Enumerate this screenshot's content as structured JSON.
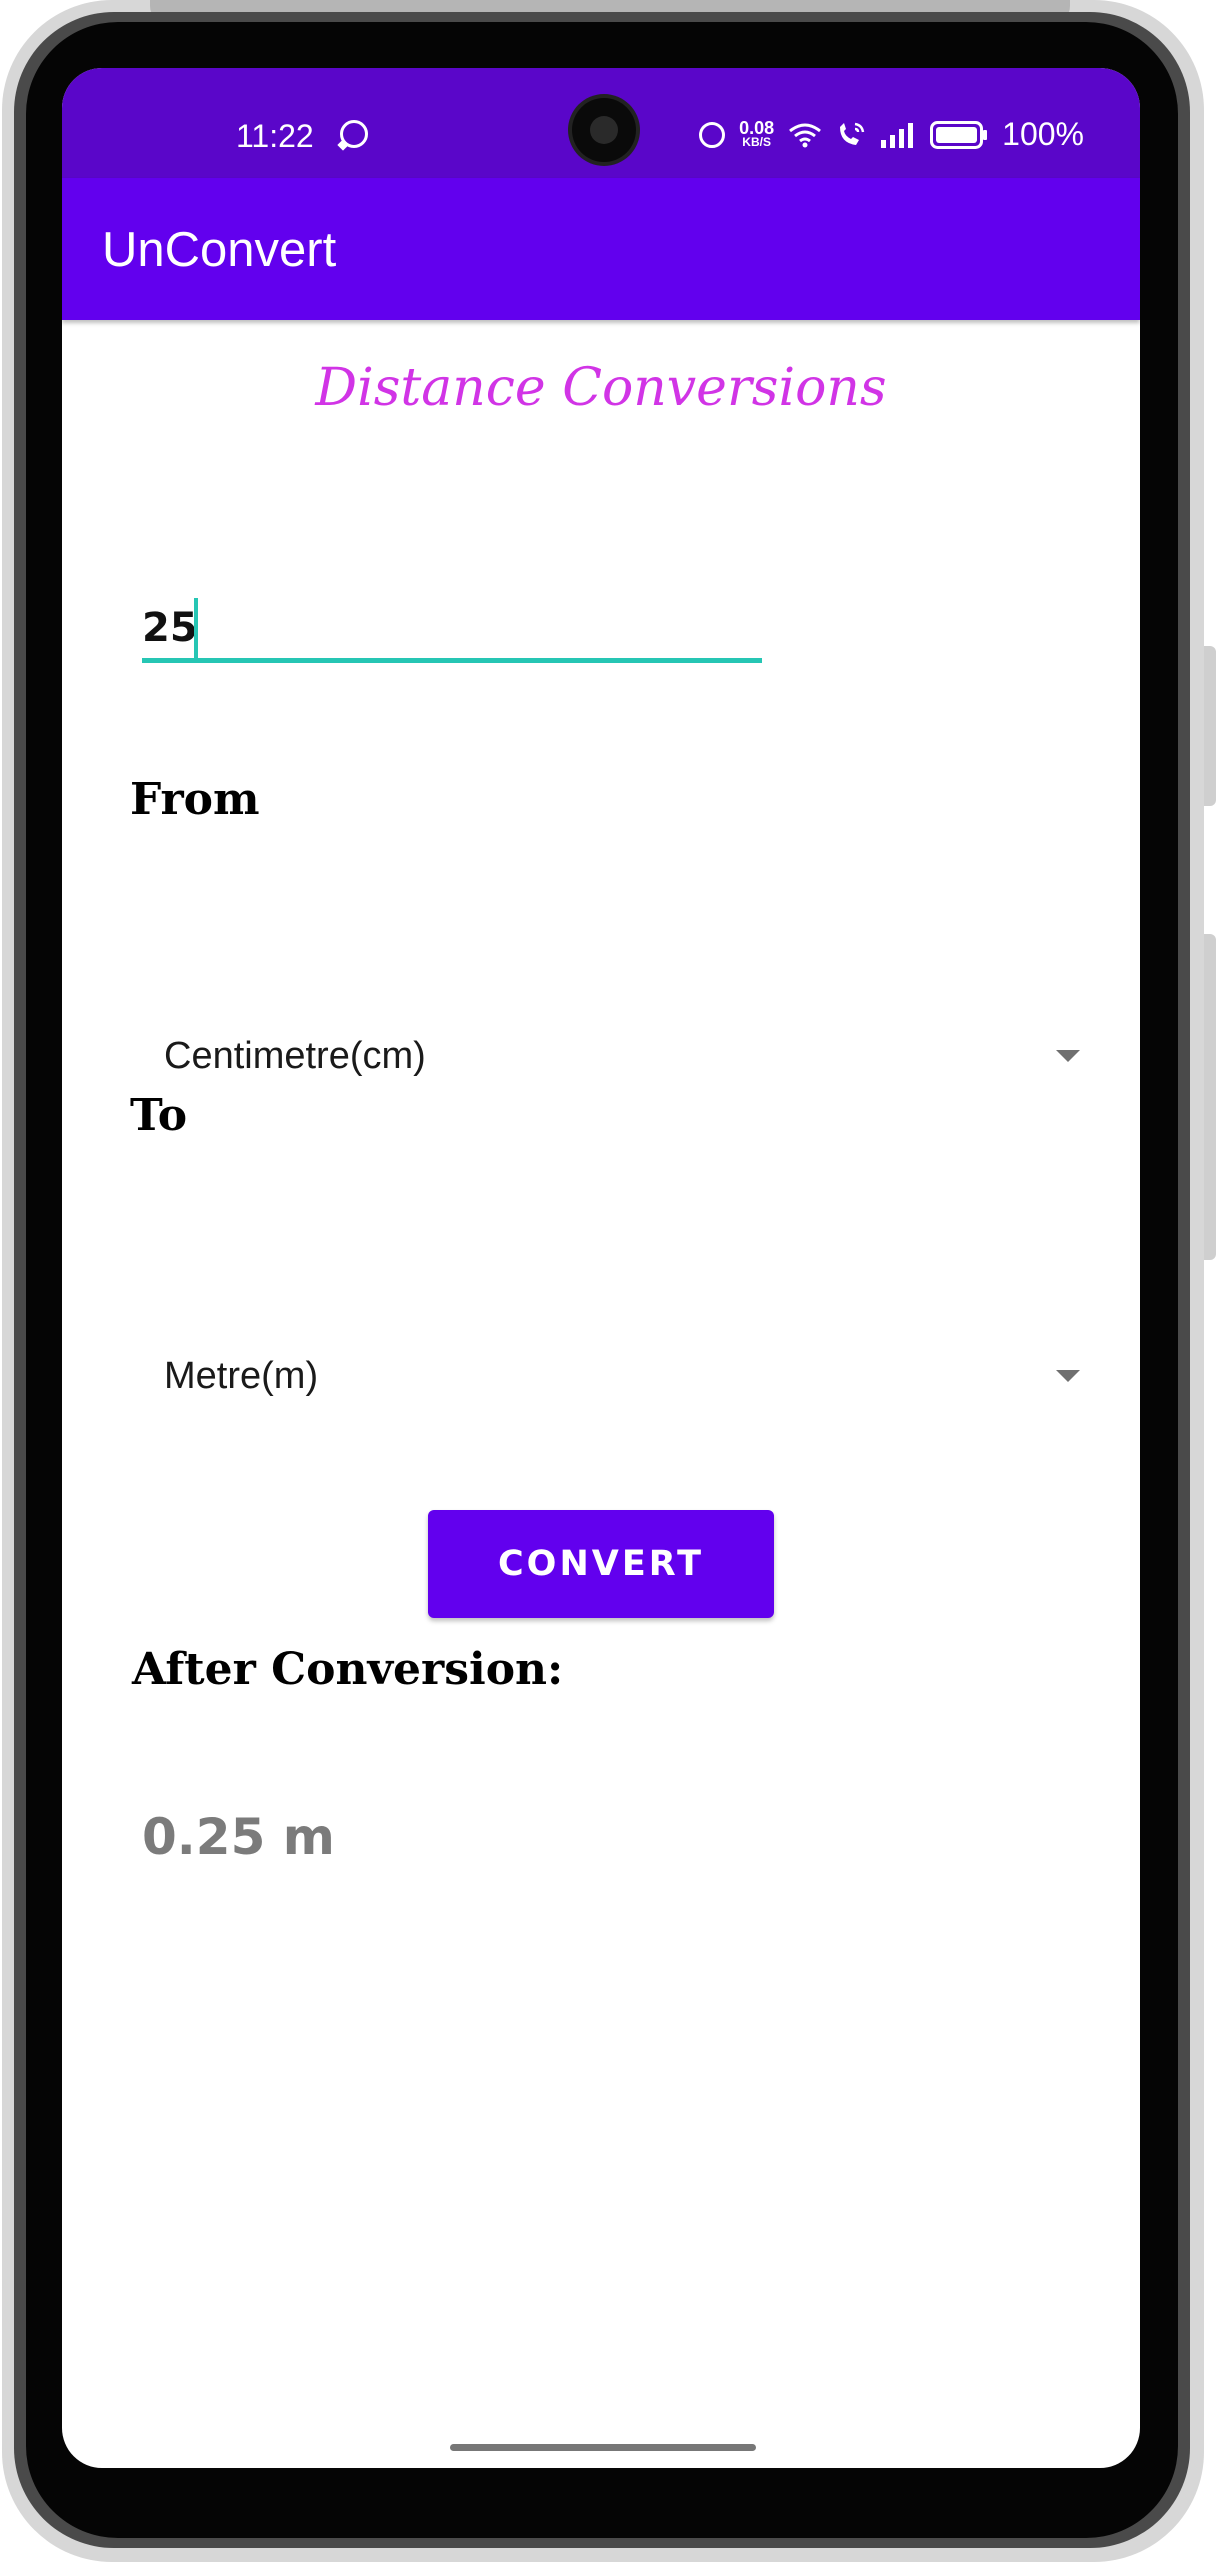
{
  "status_bar": {
    "time": "11:22",
    "net_speed_value": "0.08",
    "net_speed_unit": "KB/S",
    "battery_percent": "100%"
  },
  "app_bar": {
    "title": "UnConvert"
  },
  "main": {
    "heading": "Distance Conversions",
    "input_value": "25",
    "from_label": "From",
    "from_selected": "Centimetre(cm)",
    "to_label": "To",
    "to_selected": "Metre(m)",
    "convert_button_label": "CONVERT",
    "result_label": "After Conversion:",
    "result_value": "0.25 m"
  },
  "colors": {
    "status_bar": "#5a06c9",
    "app_bar": "#6200ee",
    "heading": "#d134e6",
    "input_underline": "#26c6b4",
    "button": "#6200ee",
    "result_text": "#7b7b7b"
  },
  "icons": [
    "whatsapp-icon",
    "alarm-icon",
    "wifi-icon",
    "wifi-calling-icon",
    "signal-icon",
    "battery-icon",
    "dropdown-arrow-icon"
  ]
}
